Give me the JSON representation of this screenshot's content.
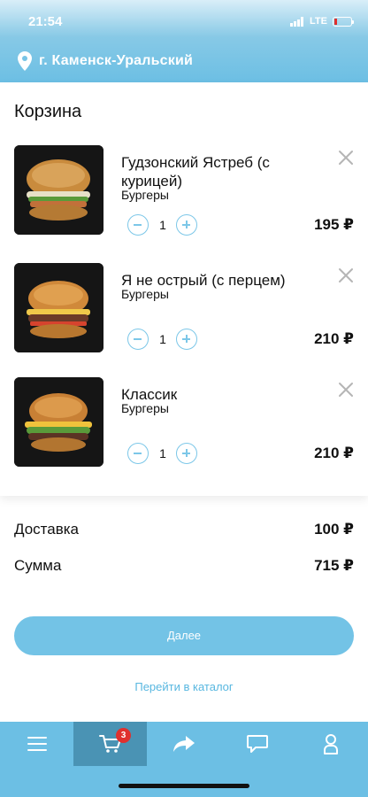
{
  "status_bar": {
    "time": "21:54",
    "network": "LTE"
  },
  "location": {
    "city": "г. Каменск-Уральский",
    "icon": "location-pin-icon"
  },
  "cart": {
    "title": "Корзина",
    "items": [
      {
        "name": "Гудзонский Ястреб (с курицей)",
        "category": "Бургеры",
        "quantity": "1",
        "price": "195 ₽"
      },
      {
        "name": "Я не острый (с перцем)",
        "category": "Бургеры",
        "quantity": "1",
        "price": "210 ₽"
      },
      {
        "name": "Классик",
        "category": "Бургеры",
        "quantity": "1",
        "price": "210 ₽"
      }
    ]
  },
  "summary": {
    "delivery_label": "Доставка",
    "delivery_value": "100 ₽",
    "total_label": "Сумма",
    "total_value": "715 ₽"
  },
  "actions": {
    "next_label": "Далее",
    "catalog_link": "Перейти в каталог"
  },
  "tabbar": {
    "tabs": [
      {
        "icon": "menu-icon"
      },
      {
        "icon": "cart-icon",
        "badge": "3",
        "active": true
      },
      {
        "icon": "share-icon"
      },
      {
        "icon": "chat-icon"
      },
      {
        "icon": "profile-icon"
      }
    ]
  },
  "colors": {
    "accent": "#6cbfe4",
    "active_tab": "#4a93b4",
    "badge": "#e0302e",
    "link": "#58b7e0"
  }
}
